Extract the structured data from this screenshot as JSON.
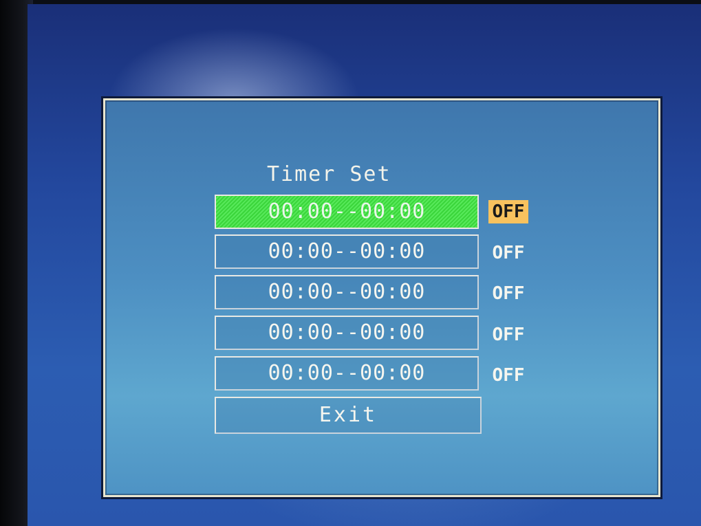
{
  "menu": {
    "title": "Timer Set",
    "timers": [
      {
        "range": "00:00--00:00",
        "status": "OFF",
        "selected": true
      },
      {
        "range": "00:00--00:00",
        "status": "OFF",
        "selected": false
      },
      {
        "range": "00:00--00:00",
        "status": "OFF",
        "selected": false
      },
      {
        "range": "00:00--00:00",
        "status": "OFF",
        "selected": false
      },
      {
        "range": "00:00--00:00",
        "status": "OFF",
        "selected": false
      }
    ],
    "exit_label": "Exit"
  },
  "colors": {
    "selection_green": "#3bd53b",
    "status_highlight": "#f8c25e",
    "panel_border": "#e9e6cf",
    "panel_blue": "#4d8fc2"
  }
}
